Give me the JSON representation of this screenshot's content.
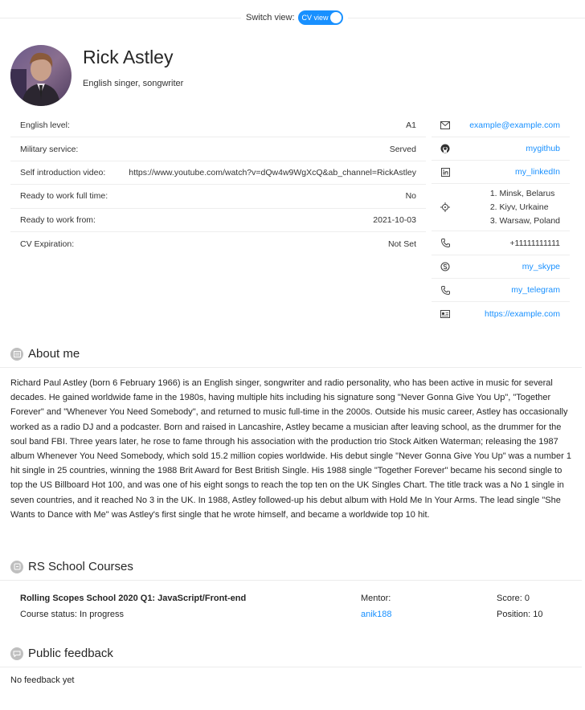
{
  "header": {
    "switch_label": "Switch view:",
    "toggle_label": "CV view",
    "toggle_on": true,
    "accent_color": "#1890ff"
  },
  "profile": {
    "name": "Rick Astley",
    "headline": "English singer, songwriter"
  },
  "info": [
    {
      "key": "English level:",
      "value": "A1"
    },
    {
      "key": "Military service:",
      "value": "Served"
    },
    {
      "key": "Self introduction video:",
      "value": "https://www.youtube.com/watch?v=dQw4w9WgXcQ&ab_channel=RickAstley"
    },
    {
      "key": "Ready to work full time:",
      "value": "No"
    },
    {
      "key": "Ready to work from:",
      "value": "2021-10-03"
    },
    {
      "key": "CV Expiration:",
      "value": "Not Set"
    }
  ],
  "contacts": {
    "email": {
      "icon": "mail-icon",
      "value": "example@example.com"
    },
    "github": {
      "icon": "github-icon",
      "value": "mygithub"
    },
    "linkedin": {
      "icon": "linkedin-icon",
      "value": "my_linkedIn"
    },
    "locations": {
      "icon": "location-icon",
      "items": [
        "1. Minsk, Belarus",
        "2. Kiyv, Urkaine",
        "3. Warsaw, Poland"
      ]
    },
    "phone": {
      "icon": "phone-icon",
      "value": "+11111111111"
    },
    "skype": {
      "icon": "skype-icon",
      "value": "my_skype"
    },
    "telegram": {
      "icon": "telegram-icon",
      "value": "my_telegram"
    },
    "website": {
      "icon": "website-icon",
      "value": "https://example.com"
    }
  },
  "about": {
    "title": "About me",
    "text": "Richard Paul Astley (born 6 February 1966) is an English singer, songwriter and radio personality, who has been active in music for several decades. He gained worldwide fame in the 1980s, having multiple hits including his signature song \"Never Gonna Give You Up\", \"Together Forever\" and \"Whenever You Need Somebody\", and returned to music full-time in the 2000s. Outside his music career, Astley has occasionally worked as a radio DJ and a podcaster. Born and raised in Lancashire, Astley became a musician after leaving school, as the drummer for the soul band FBI. Three years later, he rose to fame through his association with the production trio Stock Aitken Waterman; releasing the 1987 album Whenever You Need Somebody, which sold 15.2 million copies worldwide. His debut single \"Never Gonna Give You Up\" was a number 1 hit single in 25 countries, winning the 1988 Brit Award for Best British Single. His 1988 single \"Together Forever\" became his second single to top the US Billboard Hot 100, and was one of his eight songs to reach the top ten on the UK Singles Chart. The title track was a No 1 single in seven countries, and it reached No 3 in the UK. In 1988, Astley followed-up his debut album with Hold Me In Your Arms. The lead single \"She Wants to Dance with Me\" was Astley's first single that he wrote himself, and became a worldwide top 10 hit."
  },
  "courses": {
    "title": "RS School Courses",
    "items": [
      {
        "name": "Rolling Scopes School 2020 Q1: JavaScript/Front-end",
        "status": "Course status: In progress",
        "mentor_label": "Mentor:",
        "mentor": "anik188",
        "score": "Score: 0",
        "position": "Position: 10"
      }
    ]
  },
  "feedback": {
    "title": "Public feedback",
    "empty_text": "No feedback yet"
  }
}
